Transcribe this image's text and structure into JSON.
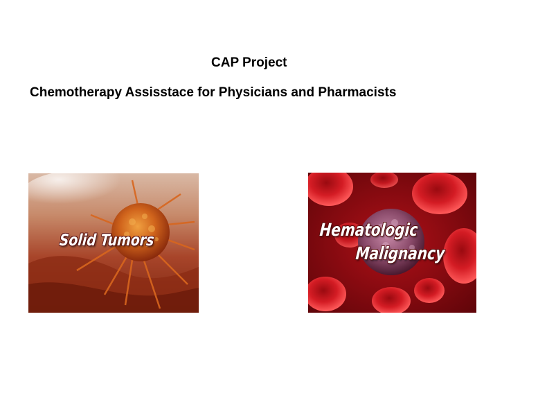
{
  "header": {
    "title": "CAP Project",
    "subtitle": "Chemotherapy Assisstace for Physicians and Pharmacists"
  },
  "tiles": [
    {
      "lines": [
        "Solid Tumors"
      ],
      "image": "tumor-cell-image"
    },
    {
      "lines": [
        "Hematologic",
        "Malignancy"
      ],
      "image": "blood-cells-image"
    }
  ],
  "colors": {
    "background": "#ffffff",
    "text": "#000000",
    "tile_label": "#ffffff",
    "blood_red": "#c2121c",
    "tumor_orange": "#c85a1e"
  }
}
